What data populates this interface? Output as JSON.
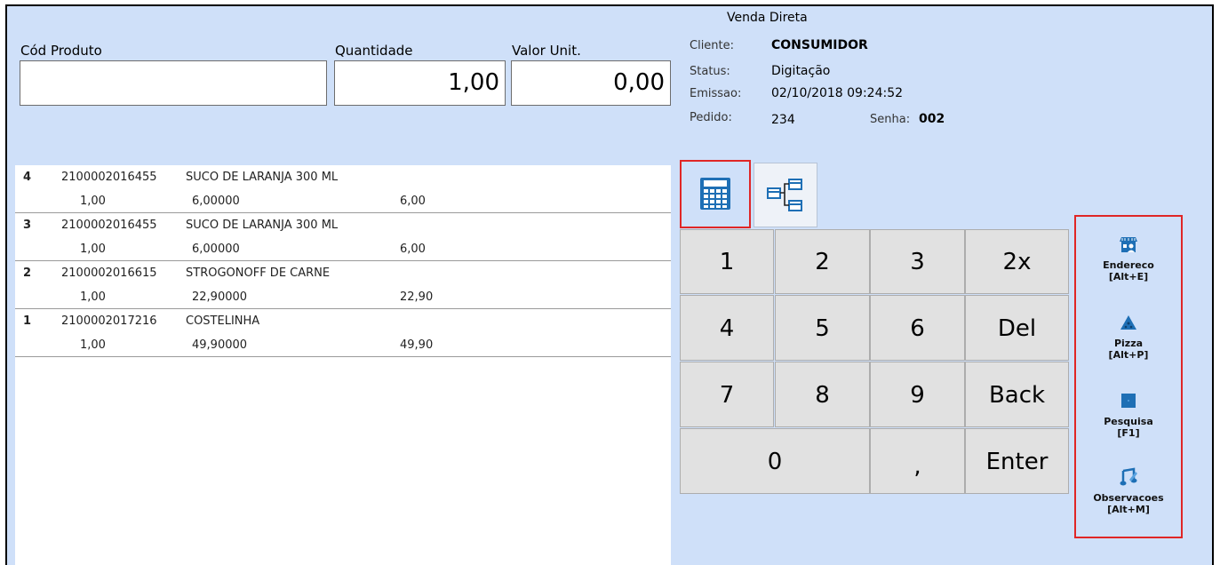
{
  "header": {
    "title": "Venda Direta"
  },
  "fields": {
    "cod_produto_label": "Cód Produto",
    "cod_produto_value": "",
    "quantidade_label": "Quantidade",
    "quantidade_value": "1,00",
    "valor_unit_label": "Valor Unit.",
    "valor_unit_value": "0,00"
  },
  "info": {
    "cliente_label": "Cliente:",
    "cliente_value": "CONSUMIDOR",
    "status_label": "Status:",
    "status_value": "Digitação",
    "emissao_label": "Emissao:",
    "emissao_value": "02/10/2018 09:24:52",
    "pedido_label": "Pedido:",
    "pedido_value": "234",
    "senha_label": "Senha:",
    "senha_value": "002"
  },
  "items": [
    {
      "num": "4",
      "code": "2100002016455",
      "desc": "SUCO DE LARANJA 300 ML",
      "qty": "1,00",
      "price": "6,00000",
      "total": "6,00"
    },
    {
      "num": "3",
      "code": "2100002016455",
      "desc": "SUCO DE LARANJA 300 ML",
      "qty": "1,00",
      "price": "6,00000",
      "total": "6,00"
    },
    {
      "num": "2",
      "code": "2100002016615",
      "desc": "STROGONOFF DE CARNE",
      "qty": "1,00",
      "price": "22,90000",
      "total": "22,90"
    },
    {
      "num": "1",
      "code": "2100002017216",
      "desc": "COSTELINHA",
      "qty": "1,00",
      "price": "49,90000",
      "total": "49,90"
    }
  ],
  "keypad": {
    "k1": "1",
    "k2": "2",
    "k3": "3",
    "k2x": "2x",
    "k4": "4",
    "k5": "5",
    "k6": "6",
    "kdel": "Del",
    "k7": "7",
    "k8": "8",
    "k9": "9",
    "kback": "Back",
    "k0": "0",
    "kcomma": ",",
    "kenter": "Enter"
  },
  "side": {
    "endereco": "Endereco",
    "endereco_key": "[Alt+E]",
    "pizza": "Pizza",
    "pizza_key": "[Alt+P]",
    "pesquisa": "Pesquisa",
    "pesquisa_key": "[F1]",
    "observacoes": "Observacoes",
    "observacoes_key": "[Alt+M]"
  },
  "colors": {
    "panel_bg": "#cfe0f9",
    "highlight": "#e02626",
    "icon_blue": "#1e6fb5"
  },
  "icons": [
    "calculator-icon",
    "tree-table-icon",
    "store-icon",
    "pizza-icon",
    "search-icon",
    "note-icon"
  ]
}
